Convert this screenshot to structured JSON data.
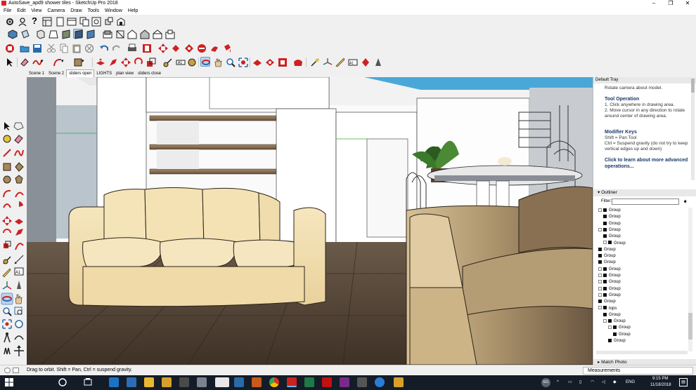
{
  "window": {
    "title": "AutoSave_apd9 shower tiles - SketchUp Pro 2018",
    "minimize": "–",
    "maximize": "❐",
    "close": "✕"
  },
  "menu": [
    "File",
    "Edit",
    "View",
    "Camera",
    "Draw",
    "Tools",
    "Window",
    "Help"
  ],
  "scenes": {
    "tabs": [
      "Scene 1",
      "Scene 2",
      "sliders open",
      "LIGHTS",
      "plan view",
      "sliders close"
    ],
    "active_index": 2
  },
  "tray": {
    "title": "Default Tray",
    "intro": "Rotate camera about model.",
    "tool_operation_heading": "Tool Operation",
    "tool_steps": [
      "1. Click anywhere in drawing area.",
      "2. Move cursor in any direction to rotate around center of drawing area."
    ],
    "modifier_heading": "Modifier Keys",
    "modifiers": [
      "Shift = Pan Tool",
      "Ctrl = Suspend gravity (do not try to keep vertical edges up and down)"
    ],
    "learn_more": "Click to learn about more advanced operations...",
    "outliner_title": "Outliner",
    "filter_label": "Filter:",
    "filter_value": "",
    "outliner_items": [
      {
        "label": "Group",
        "indent": 1,
        "expander": "−"
      },
      {
        "label": "Group",
        "indent": 2,
        "expander": ""
      },
      {
        "label": "Group",
        "indent": 2,
        "expander": ""
      },
      {
        "label": "Group",
        "indent": 1,
        "expander": "−"
      },
      {
        "label": "Group",
        "indent": 2,
        "expander": ""
      },
      {
        "label": "Group",
        "indent": 2,
        "expander": "+"
      },
      {
        "label": "Group",
        "indent": 1,
        "expander": ""
      },
      {
        "label": "Group",
        "indent": 1,
        "expander": ""
      },
      {
        "label": "Group",
        "indent": 1,
        "expander": ""
      },
      {
        "label": "Group",
        "indent": 1,
        "expander": "+"
      },
      {
        "label": "Group",
        "indent": 1,
        "expander": "+"
      },
      {
        "label": "Group",
        "indent": 1,
        "expander": "+"
      },
      {
        "label": "Group",
        "indent": 1,
        "expander": "+"
      },
      {
        "label": "Group",
        "indent": 1,
        "expander": "+"
      },
      {
        "label": "Group",
        "indent": 1,
        "expander": ""
      },
      {
        "label": "tops",
        "indent": 1,
        "expander": "−"
      },
      {
        "label": "Group",
        "indent": 2,
        "expander": ""
      },
      {
        "label": "Group",
        "indent": 2,
        "expander": "−"
      },
      {
        "label": "Group",
        "indent": 3,
        "expander": "−"
      },
      {
        "label": "Group",
        "indent": 4,
        "expander": ""
      },
      {
        "label": "Group",
        "indent": 3,
        "expander": ""
      }
    ],
    "match_photo": "Match Photo"
  },
  "status": {
    "message": "Drag to orbit. Shift = Pan, Ctrl = suspend gravity.",
    "measurements_label": "Measurements"
  },
  "taskbar": {
    "time": "9:15 PM",
    "date": "11/18/2018",
    "language": "ENG",
    "user_initials": "EG"
  },
  "colors": {
    "accent": "#2f78c4",
    "taskbar": "#141c28",
    "sofa": "#f1dfb3",
    "floor": "#5a4a3c"
  }
}
